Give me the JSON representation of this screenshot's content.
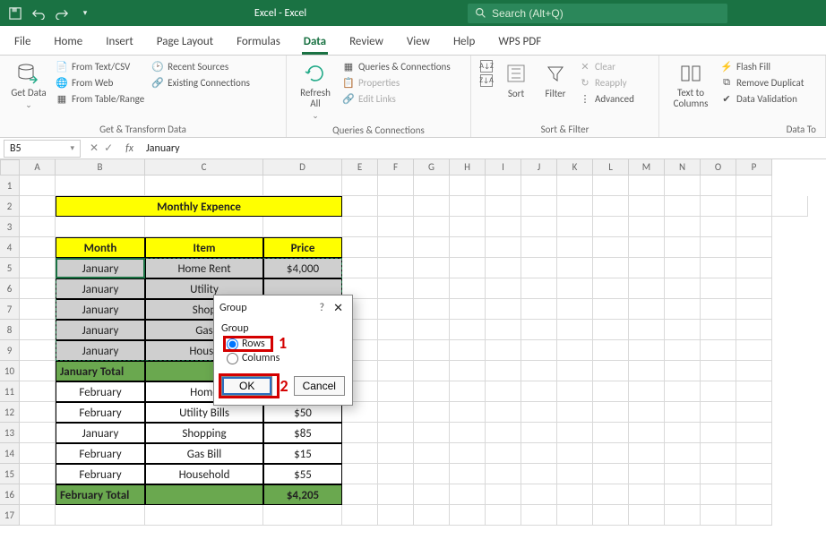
{
  "titlebar": {
    "title": "Excel - Excel",
    "search_placeholder": "Search (Alt+Q)"
  },
  "tabs": [
    "File",
    "Home",
    "Insert",
    "Page Layout",
    "Formulas",
    "Data",
    "Review",
    "View",
    "Help",
    "WPS PDF"
  ],
  "active_tab": "Data",
  "ribbon": {
    "g1": {
      "label": "Get & Transform Data",
      "get_data": "Get Data",
      "drop": "⌄",
      "from_text": "From Text/CSV",
      "from_web": "From Web",
      "from_table": "From Table/Range",
      "recent": "Recent Sources",
      "existing": "Existing Connections"
    },
    "g2": {
      "label": "Queries & Connections",
      "refresh": "Refresh All",
      "drop": "⌄",
      "queries": "Queries & Connections",
      "properties": "Properties",
      "edit_links": "Edit Links"
    },
    "g3": {
      "label": "Sort & Filter",
      "sort": "Sort",
      "filter": "Filter",
      "clear": "Clear",
      "reapply": "Reapply",
      "advanced": "Advanced"
    },
    "g4": {
      "label": "Data To",
      "ttc": "Text to Columns",
      "flash": "Flash Fill",
      "remove_dup": "Remove Duplicat",
      "data_val": "Data Validation"
    }
  },
  "namebox": "B5",
  "formula": "January",
  "col_headers": [
    "A",
    "B",
    "C",
    "D",
    "E",
    "F",
    "G",
    "H",
    "I",
    "J",
    "K",
    "L",
    "M",
    "N",
    "O",
    "P"
  ],
  "table": {
    "title": "Monthly Expence",
    "headers": {
      "month": "Month",
      "item": "Item",
      "price": "Price"
    },
    "rows": [
      {
        "month": "January",
        "item": "Home Rent",
        "price": "$4,000"
      },
      {
        "month": "January",
        "item": "Utility",
        "price": ""
      },
      {
        "month": "January",
        "item": "Shop",
        "price": ""
      },
      {
        "month": "January",
        "item": "Gas",
        "price": ""
      },
      {
        "month": "January",
        "item": "House",
        "price": ""
      }
    ],
    "jan_total": {
      "label": "January Total",
      "price": ""
    },
    "rows2": [
      {
        "month": "February",
        "item": "Home",
        "price": ""
      },
      {
        "month": "February",
        "item": "Utility Bills",
        "price": "$50"
      },
      {
        "month": "January",
        "item": "Shopping",
        "price": "$85"
      },
      {
        "month": "February",
        "item": "Gas Bill",
        "price": "$15"
      },
      {
        "month": "February",
        "item": "Household",
        "price": "$55"
      }
    ],
    "feb_total": {
      "label": "February Total",
      "price": "$4,205"
    }
  },
  "dialog": {
    "title": "Group",
    "group_label": "Group",
    "opt_rows": "Rows",
    "opt_cols": "Columns",
    "ok": "OK",
    "cancel": "Cancel",
    "help": "?",
    "close": "✕",
    "annot1": "1",
    "annot2": "2"
  }
}
